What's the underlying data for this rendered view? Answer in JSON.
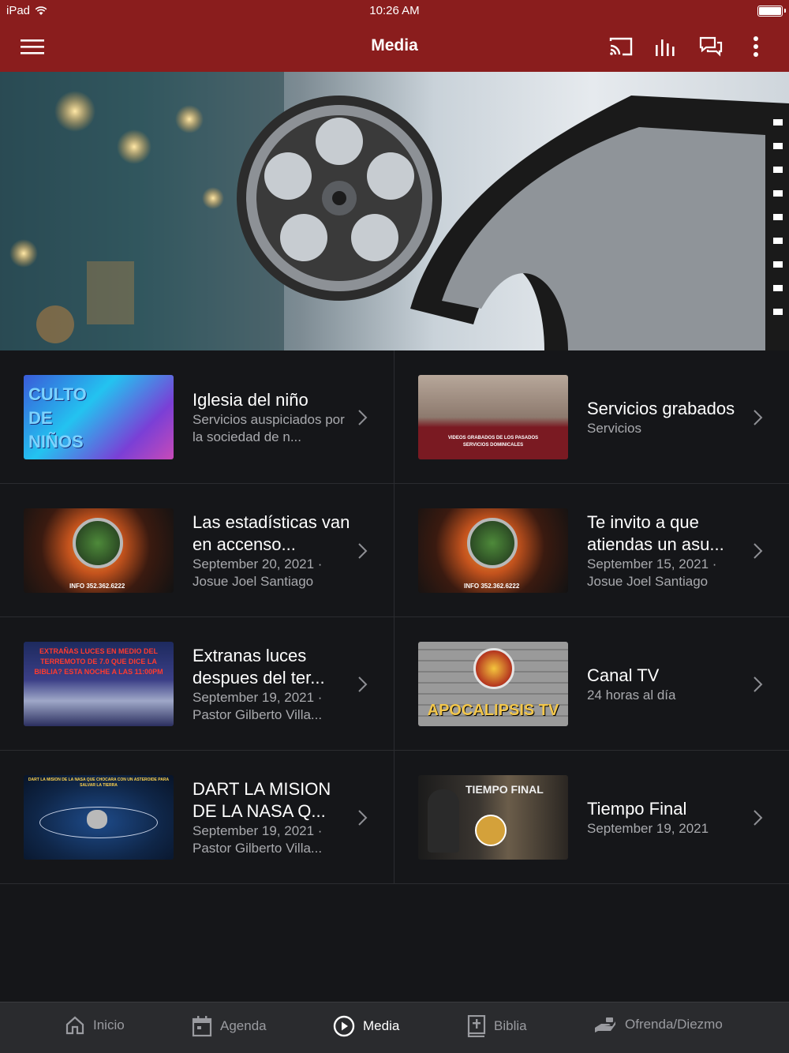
{
  "status": {
    "device": "iPad",
    "time": "10:26 AM"
  },
  "app_bar": {
    "title": "Media"
  },
  "items": [
    {
      "title": "Iglesia del niño",
      "subtitle": "Servicios auspiciados por la sociedad de n...",
      "thumb_text": "CULTO DE NIÑOS"
    },
    {
      "title": "Servicios grabados",
      "subtitle": "Servicios",
      "thumb_text": "VIDEOS GRABADOS DE LOS PASADOS SERVICIOS DOMINICALES"
    },
    {
      "title": "Las estadísticas van en accenso...",
      "subtitle": "September 20, 2021 · Josue Joel Santiago",
      "thumb_text": "INFO 352.362.6222"
    },
    {
      "title": "Te invito a que atiendas un asu...",
      "subtitle": "September 15, 2021 · Josue Joel Santiago",
      "thumb_text": "INFO 352.362.6222"
    },
    {
      "title": "Extranas luces despues del ter...",
      "subtitle": "September 19, 2021 · Pastor Gilberto Villa...",
      "thumb_text": "EXTRAÑAS LUCES EN MEDIO DEL TERREMOTO DE 7.0 QUE DICE LA BIBLIA? ESTA NOCHE A LAS 11:00PM"
    },
    {
      "title": "Canal TV",
      "subtitle": "24 horas al día",
      "thumb_text": "APOCALIPSIS TV"
    },
    {
      "title": "DART LA MISION DE LA NASA Q...",
      "subtitle": "September 19, 2021 · Pastor Gilberto Villa...",
      "thumb_text": "DART LA MISION DE LA NASA QUE CHOCARA CON UN ASTEROIDE PARA SALVAR LA TIERRA"
    },
    {
      "title": "Tiempo Final",
      "subtitle": "September 19, 2021",
      "thumb_text": "TIEMPO FINAL"
    }
  ],
  "tabs": [
    {
      "label": "Inicio",
      "icon": "home-icon"
    },
    {
      "label": "Agenda",
      "icon": "calendar-icon"
    },
    {
      "label": "Media",
      "icon": "play-circle-icon",
      "active": true
    },
    {
      "label": "Biblia",
      "icon": "bible-icon"
    },
    {
      "label": "Ofrenda/Diezmo",
      "icon": "giving-hand-icon"
    }
  ],
  "colors": {
    "accent": "#8a1d1d",
    "background": "#151619",
    "tabbar": "#2a2b2e"
  }
}
